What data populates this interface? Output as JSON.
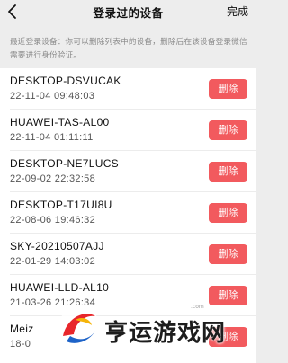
{
  "navbar": {
    "title": "登录过的设备",
    "done_label": "完成"
  },
  "notice": "最近登录设备：你可以删除列表中的设备，删除后在该设备登录微信需要进行身份验证。",
  "devices": [
    {
      "name": "DESKTOP-DSVUCAK",
      "time": "22-11-04 09:48:03",
      "delete_label": "删除"
    },
    {
      "name": "HUAWEI-TAS-AL00",
      "time": "22-11-04 01:11:11",
      "delete_label": "删除"
    },
    {
      "name": "DESKTOP-NE7LUCS",
      "time": "22-09-02 22:32:58",
      "delete_label": "删除"
    },
    {
      "name": "DESKTOP-T17UI8U",
      "time": "22-08-06 19:46:32",
      "delete_label": "删除"
    },
    {
      "name": "SKY-20210507AJJ",
      "time": "22-01-29 14:03:02",
      "delete_label": "删除"
    },
    {
      "name": "HUAWEI-LLD-AL10",
      "time": "21-03-26 21:26:34",
      "delete_label": "删除"
    },
    {
      "name": "Meiz",
      "time": "18-0",
      "delete_label": "删除"
    }
  ],
  "watermark": {
    "text": "亨运游戏网",
    "domain": ".com"
  },
  "colors": {
    "background": "#ededed",
    "delete_button": "#f25a5e",
    "list_background": "#ffffff"
  }
}
